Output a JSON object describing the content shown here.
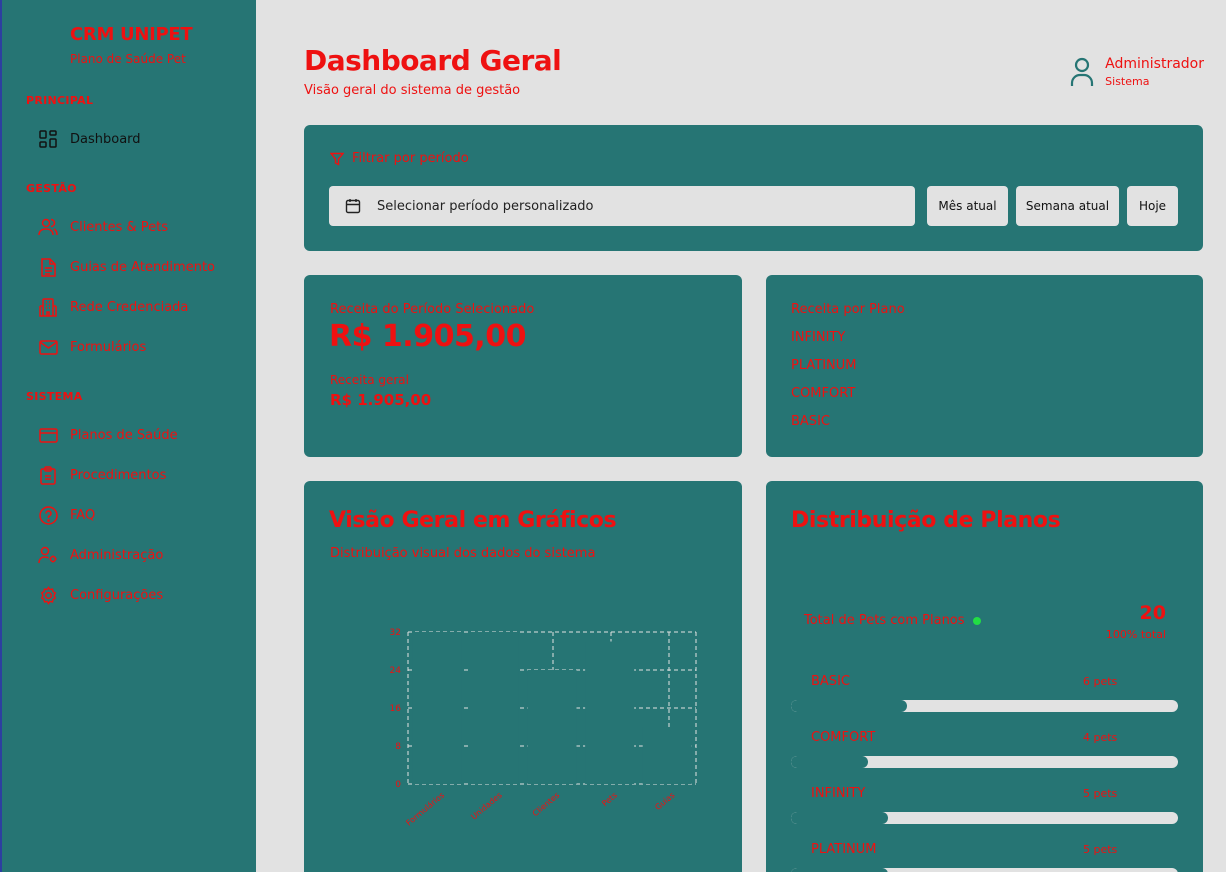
{
  "brand": {
    "title": "CRM UNIPET",
    "subtitle": "Plano de Saúde Pet"
  },
  "sidebar": {
    "sections": [
      {
        "label": "PRINCIPAL"
      },
      {
        "label": "GESTÃO"
      },
      {
        "label": "SISTEMA"
      }
    ],
    "items": [
      {
        "label": "Dashboard",
        "icon": "dashboard-icon",
        "active": true
      },
      {
        "label": "Clientes & Pets",
        "icon": "users-icon"
      },
      {
        "label": "Guias de Atendimento",
        "icon": "document-icon"
      },
      {
        "label": "Rede Credenciada",
        "icon": "building-icon"
      },
      {
        "label": "Formulários",
        "icon": "mail-icon"
      },
      {
        "label": "Planos de Saúde",
        "icon": "credit-card-icon"
      },
      {
        "label": "Procedimentos",
        "icon": "clipboard-icon"
      },
      {
        "label": "FAQ",
        "icon": "help-circle-icon"
      },
      {
        "label": "Administração",
        "icon": "user-cog-icon"
      },
      {
        "label": "Configurações",
        "icon": "gear-icon"
      }
    ]
  },
  "header": {
    "title": "Dashboard Geral",
    "subtitle": "Visão geral do sistema de gestão",
    "user_name": "Administrador",
    "user_role": "Sistema"
  },
  "filter": {
    "title": "Filtrar por período",
    "date_placeholder": "Selecionar período personalizado",
    "buttons": [
      "Mês atual",
      "Semana atual",
      "Hoje"
    ]
  },
  "revenue": {
    "label": "Receita do Período Selecionado",
    "value": "R$ 1.905,00",
    "general_label": "Receita geral",
    "general_value": "R$ 1.905,00"
  },
  "revenue_by_plan": {
    "label": "Receita por Plano",
    "plans": [
      "INFINITY",
      "PLATINUM",
      "COMFORT",
      "BASIC"
    ]
  },
  "overview": {
    "title": "Visão Geral em Gráficos",
    "subtitle": "Distribuição visual dos dados do sistema"
  },
  "chart_data": {
    "type": "bar",
    "categories": [
      "Formulários",
      "Unidades",
      "Clientes",
      "Pets",
      "Guias"
    ],
    "values": [
      32,
      32,
      24,
      30,
      12
    ],
    "yticks": [
      "0",
      "8",
      "16",
      "24",
      "32"
    ],
    "ylim": [
      0,
      32
    ],
    "grid": true
  },
  "distribution": {
    "title": "Distribuição de Planos",
    "total_label": "Total de Pets com Planos",
    "total_value": "20",
    "total_pct": "100% total",
    "plans": [
      {
        "name": "BASIC",
        "count": "6 pets",
        "fraction": 0.3
      },
      {
        "name": "COMFORT",
        "count": "4 pets",
        "fraction": 0.2
      },
      {
        "name": "INFINITY",
        "count": "5 pets",
        "fraction": 0.25
      },
      {
        "name": "PLATINUM",
        "count": "5 pets",
        "fraction": 0.25
      }
    ]
  },
  "colors": {
    "panel": "#267574",
    "accent": "#ee1111",
    "background": "#e2e2e2",
    "dot": "#22dd44"
  }
}
